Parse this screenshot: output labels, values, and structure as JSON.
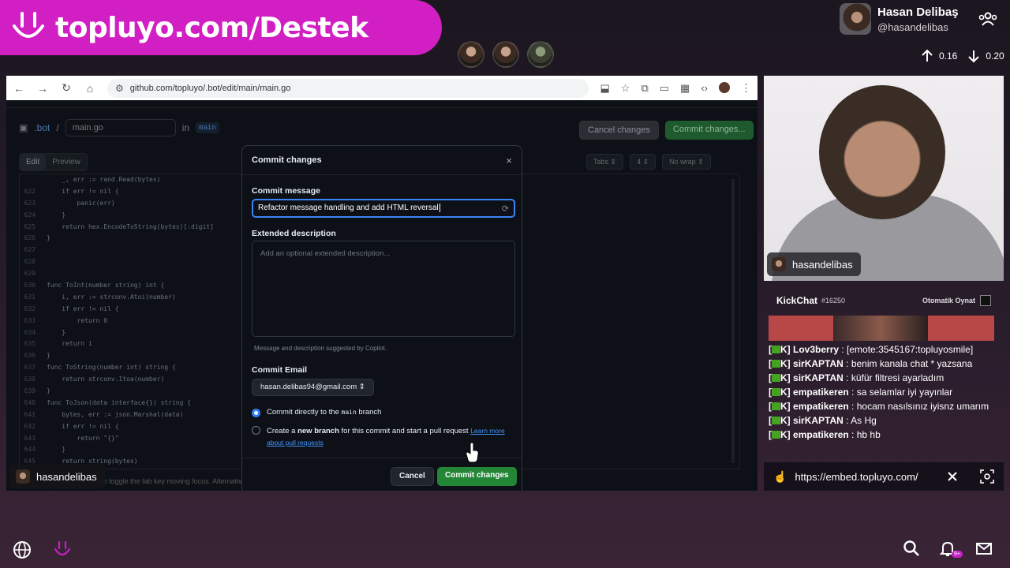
{
  "banner": {
    "text": "topluyo.com/Destek"
  },
  "profile": {
    "name": "Hasan Delibaş",
    "handle": "@hasandelibas"
  },
  "net": {
    "up": "0.16",
    "down": "0.20"
  },
  "browser": {
    "url": "github.com/topluyo/.bot/edit/main/main.go"
  },
  "github": {
    "repo": ".bot",
    "separator": "/",
    "filename": "main.go",
    "in_label": "in",
    "branch": "main",
    "cancel_changes": "Cancel changes",
    "commit_changes": "Commit changes...",
    "tab_edit": "Edit",
    "tab_preview": "Preview",
    "indent_mode": "Tabs",
    "indent_size": "4",
    "wrap_mode": "No wrap",
    "footer_hint": "to toggle the tab key moving focus. Alternatively, use esc then tab to move to the next interactive element on the page.",
    "code_lines": [
      {
        "n": "",
        "t": "    _, err := rand.Read(bytes)"
      },
      {
        "n": "622",
        "t": "    if err != nil {"
      },
      {
        "n": "623",
        "t": "        panic(err)"
      },
      {
        "n": "624",
        "t": "    }"
      },
      {
        "n": "625",
        "t": "    return hex.EncodeToString(bytes)[:digit]"
      },
      {
        "n": "626",
        "t": "}"
      },
      {
        "n": "627",
        "t": ""
      },
      {
        "n": "628",
        "t": ""
      },
      {
        "n": "629",
        "t": ""
      },
      {
        "n": "630",
        "t": "func ToInt(number string) int {"
      },
      {
        "n": "631",
        "t": "    i, err := strconv.Atoi(number)"
      },
      {
        "n": "632",
        "t": "    if err != nil {"
      },
      {
        "n": "633",
        "t": "        return 0"
      },
      {
        "n": "634",
        "t": "    }"
      },
      {
        "n": "635",
        "t": "    return i"
      },
      {
        "n": "636",
        "t": "}"
      },
      {
        "n": "637",
        "t": "func ToString(number int) string {"
      },
      {
        "n": "638",
        "t": "    return strconv.Itoa(number)"
      },
      {
        "n": "639",
        "t": "}"
      },
      {
        "n": "640",
        "t": "func ToJson(data interface{}) string {"
      },
      {
        "n": "641",
        "t": "    bytes, err := json.Marshal(data)"
      },
      {
        "n": "642",
        "t": "    if err != nil {"
      },
      {
        "n": "643",
        "t": "        return \"{}\""
      },
      {
        "n": "644",
        "t": "    }"
      },
      {
        "n": "645",
        "t": "    return string(bytes)"
      }
    ]
  },
  "modal": {
    "title": "Commit changes",
    "close": "×",
    "message_label": "Commit message",
    "message_value": "Refactor message handling and add HTML reversal",
    "desc_label": "Extended description",
    "desc_placeholder": "Add an optional extended description...",
    "copilot_note": "Message and description suggested by Copilot.",
    "email_label": "Commit Email",
    "email_value": "hasan.delibas94@gmail.com",
    "radio_direct_prefix": "Commit directly to the",
    "radio_direct_branch": "main",
    "radio_direct_suffix": "branch",
    "radio_new_prefix": "Create a",
    "radio_new_bold": "new branch",
    "radio_new_suffix": "for this commit and start a pull request",
    "radio_new_learn": "Learn more about pull requests",
    "cancel": "Cancel",
    "commit": "Commit changes"
  },
  "webcam": {
    "label": "hasandelibas"
  },
  "chat": {
    "title": "KickChat",
    "count": "#16250",
    "autoplay": "Otomatik Oynat",
    "messages": [
      {
        "tag": "[",
        "tag2": "K]",
        "user": "Lov3berry",
        "text": " : [emote:3545167:topluyosmile]"
      },
      {
        "tag": "[",
        "tag2": "K]",
        "user": "sirKAPTAN",
        "text": " : benim kanala chat * yazsana"
      },
      {
        "tag": "[",
        "tag2": "K]",
        "user": "sirKAPTAN",
        "text": " : küfür filtresi ayarladım"
      },
      {
        "tag": "[",
        "tag2": "K]",
        "user": "empatikeren",
        "text": " : sa selamlar iyi yayınlar"
      },
      {
        "tag": "[",
        "tag2": "K]",
        "user": "empatikeren",
        "text": " : hocam nasılsınız iyisnz umarım"
      },
      {
        "tag": "[",
        "tag2": "K]",
        "user": "sirKAPTAN",
        "text": " : As Hg"
      },
      {
        "tag": "[",
        "tag2": "K]",
        "user": "empatikeren",
        "text": " : hb hb"
      }
    ],
    "embed_url": "https://embed.topluyo.com/"
  },
  "overlay": {
    "label": "hasandelibas"
  },
  "taskbar": {
    "notif_count": "9+"
  }
}
